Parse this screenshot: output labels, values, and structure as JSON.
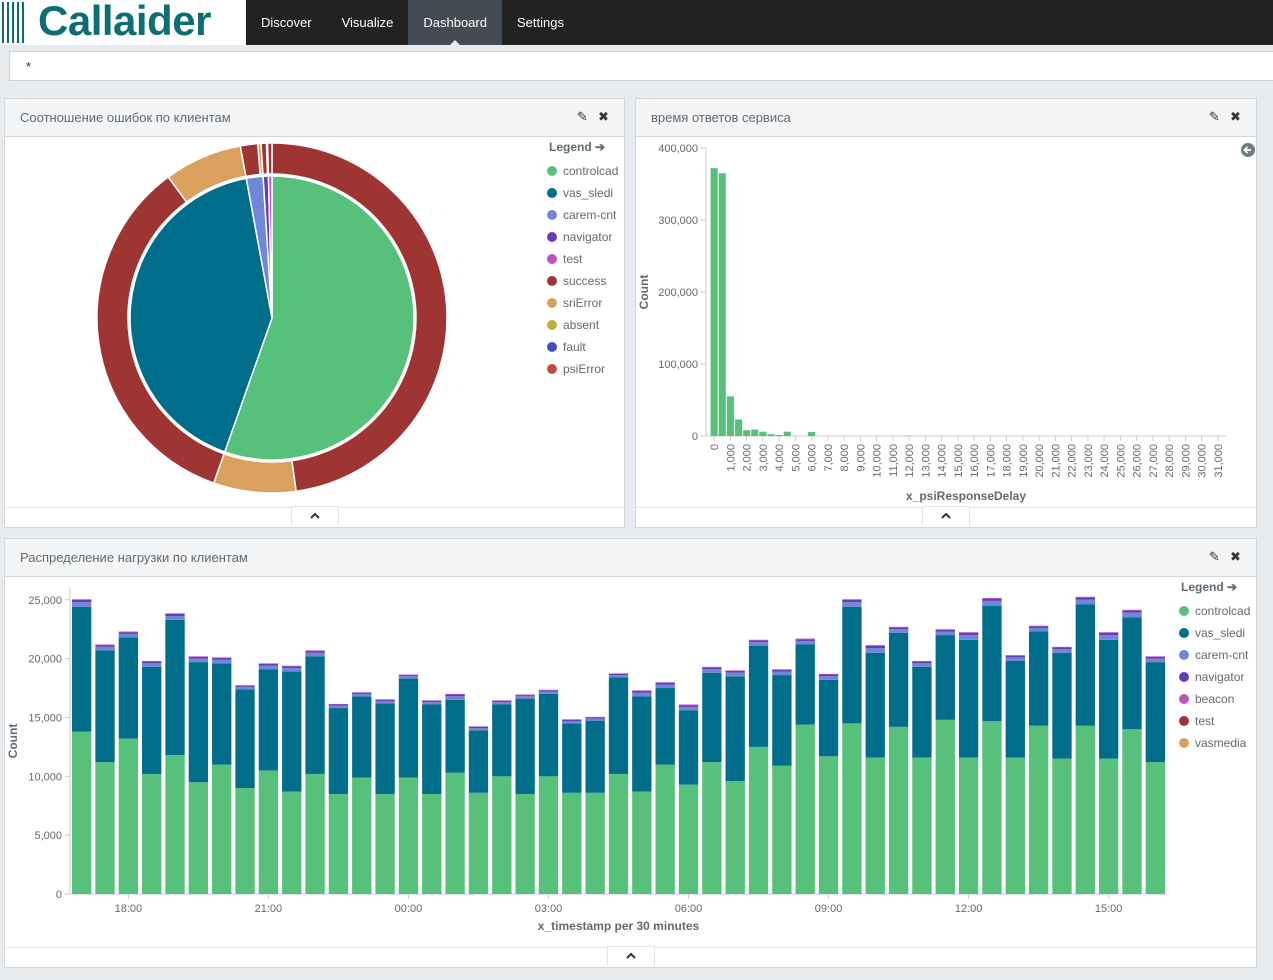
{
  "app": {
    "logo_text": "Callaider"
  },
  "nav": {
    "items": [
      "Discover",
      "Visualize",
      "Dashboard",
      "Settings"
    ],
    "active_index": 2
  },
  "query": {
    "value": "*"
  },
  "panels": {
    "errors": {
      "title": "Соотношение ошибок по клиентам"
    },
    "response": {
      "title": "время ответов сервиса"
    },
    "load": {
      "title": "Распределение нагрузки по клиентам"
    }
  },
  "legends": {
    "errors": {
      "title": "Legend",
      "items": [
        {
          "label": "controlcad",
          "color": "#57c17b"
        },
        {
          "label": "vas_sledi",
          "color": "#006e8a"
        },
        {
          "label": "carem-cnt",
          "color": "#6f87d8"
        },
        {
          "label": "navigator",
          "color": "#663db8"
        },
        {
          "label": "test",
          "color": "#bc52bc"
        },
        {
          "label": "success",
          "color": "#9e3533"
        },
        {
          "label": "sriError",
          "color": "#daa05d"
        },
        {
          "label": "absent",
          "color": "#bfaf40"
        },
        {
          "label": "fault",
          "color": "#4050bf"
        },
        {
          "label": "psiError",
          "color": "#bf5040"
        }
      ]
    },
    "load": {
      "title": "Legend",
      "items": [
        {
          "label": "controlcad",
          "color": "#57c17b"
        },
        {
          "label": "vas_sledi",
          "color": "#006e8a"
        },
        {
          "label": "carem-cnt",
          "color": "#6f87d8"
        },
        {
          "label": "navigator",
          "color": "#663db8"
        },
        {
          "label": "beacon",
          "color": "#bc52bc"
        },
        {
          "label": "test",
          "color": "#9e3533"
        },
        {
          "label": "vasmedia",
          "color": "#daa05d"
        }
      ]
    }
  },
  "chart_data": [
    {
      "type": "pie",
      "inner_ring": {
        "labels": [
          "controlcad",
          "vas_sledi",
          "carem-cnt",
          "navigator",
          "test"
        ],
        "values": [
          55.4,
          41.7,
          1.9,
          0.6,
          0.4
        ]
      },
      "outer_ring": {
        "labels": [
          "success",
          "sriError",
          "success",
          "sriError",
          "success",
          "sriError",
          "success",
          "sriError",
          "success"
        ],
        "colors": [
          "#9e3533",
          "#daa05d",
          "#9e3533",
          "#daa05d",
          "#9e3533",
          "#daa05d",
          "#9e3533",
          "#daa05d",
          "#9e3533"
        ],
        "values": [
          47.8,
          7.6,
          34.5,
          7.2,
          1.6,
          0.3,
          0.5,
          0.1,
          0.4
        ]
      }
    },
    {
      "type": "bar",
      "xlabel": "x_psiResponseDelay",
      "ylabel": "Count",
      "ylim": [
        0,
        400000
      ],
      "yticks": [
        0,
        100000,
        200000,
        300000,
        400000
      ],
      "xtick_labels": [
        "0",
        "1,000",
        "2,000",
        "3,000",
        "4,000",
        "5,000",
        "6,000",
        "7,000",
        "8,000",
        "9,000",
        "10,000",
        "11,000",
        "12,000",
        "13,000",
        "14,000",
        "15,000",
        "16,000",
        "17,000",
        "18,000",
        "19,000",
        "20,000",
        "21,000",
        "22,000",
        "23,000",
        "24,000",
        "25,000",
        "26,000",
        "27,000",
        "28,000",
        "29,000",
        "30,000",
        "31,000"
      ],
      "bin_width": 500,
      "bins": [
        {
          "x": 0,
          "y": 372000
        },
        {
          "x": 500,
          "y": 365000
        },
        {
          "x": 1000,
          "y": 55000
        },
        {
          "x": 1500,
          "y": 23000
        },
        {
          "x": 2000,
          "y": 8000
        },
        {
          "x": 2500,
          "y": 9000
        },
        {
          "x": 3000,
          "y": 6000
        },
        {
          "x": 3500,
          "y": 2500
        },
        {
          "x": 4000,
          "y": 1500
        },
        {
          "x": 4500,
          "y": 6000
        },
        {
          "x": 6000,
          "y": 5500
        },
        {
          "x": 12000,
          "y": 500
        }
      ]
    },
    {
      "type": "bar",
      "stacked": true,
      "xlabel": "x_timestamp per 30 minutes",
      "ylabel": "Count",
      "ylim": [
        0,
        26000
      ],
      "yticks": [
        0,
        5000,
        10000,
        15000,
        20000,
        25000
      ],
      "xtick_labels": [
        "18:00",
        "21:00",
        "00:00",
        "03:00",
        "06:00",
        "09:00",
        "12:00",
        "15:00"
      ],
      "xtick_bar_index": [
        2,
        8,
        14,
        20,
        26,
        32,
        38,
        44
      ],
      "series": [
        {
          "name": "controlcad",
          "values": [
            13800,
            11200,
            13200,
            10200,
            11800,
            9500,
            11000,
            9000,
            10500,
            8700,
            10200,
            8500,
            9900,
            8500,
            9900,
            8500,
            10300,
            8600,
            10000,
            8500,
            10000,
            8600,
            8600,
            10200,
            8700,
            11000,
            9300,
            11200,
            9600,
            12500,
            10900,
            14400,
            11700,
            14500,
            11600,
            14200,
            11600,
            14800,
            11600,
            14700,
            11600,
            14300,
            11500,
            14300,
            11500,
            14000,
            11200
          ]
        },
        {
          "name": "vas_sledi",
          "values": [
            10600,
            9500,
            8600,
            9100,
            11500,
            10200,
            8600,
            8400,
            8600,
            10200,
            10000,
            7300,
            6900,
            7700,
            8400,
            7600,
            6200,
            5300,
            6100,
            8100,
            7000,
            5900,
            6100,
            8200,
            8100,
            6500,
            6300,
            7600,
            8900,
            8600,
            7700,
            6800,
            6500,
            9900,
            8900,
            8000,
            7700,
            7200,
            10000,
            9800,
            8200,
            8000,
            9000,
            10300,
            10100,
            9500,
            8500
          ]
        },
        {
          "name": "carem-cnt",
          "values": [
            400,
            300,
            300,
            300,
            300,
            300,
            300,
            200,
            300,
            300,
            300,
            200,
            200,
            200,
            200,
            200,
            300,
            200,
            200,
            200,
            200,
            200,
            200,
            200,
            300,
            300,
            300,
            300,
            300,
            300,
            300,
            300,
            300,
            400,
            400,
            300,
            300,
            300,
            400,
            400,
            300,
            300,
            300,
            400,
            400,
            400,
            300
          ]
        },
        {
          "name": "navigator",
          "values": [
            200,
            150,
            150,
            150,
            200,
            150,
            150,
            100,
            150,
            150,
            150,
            100,
            100,
            100,
            100,
            100,
            150,
            100,
            100,
            100,
            100,
            100,
            100,
            100,
            150,
            150,
            150,
            150,
            150,
            150,
            150,
            150,
            150,
            200,
            200,
            150,
            150,
            150,
            200,
            200,
            150,
            150,
            150,
            200,
            200,
            200,
            150
          ]
        },
        {
          "name": "beacon",
          "values": [
            50,
            50,
            50,
            50,
            50,
            50,
            50,
            50,
            50,
            50,
            50,
            50,
            50,
            50,
            50,
            50,
            50,
            50,
            50,
            50,
            50,
            50,
            50,
            50,
            50,
            50,
            50,
            50,
            50,
            50,
            50,
            50,
            50,
            50,
            50,
            50,
            50,
            50,
            50,
            50,
            50,
            50,
            50,
            50,
            50,
            50,
            50
          ]
        }
      ]
    }
  ]
}
